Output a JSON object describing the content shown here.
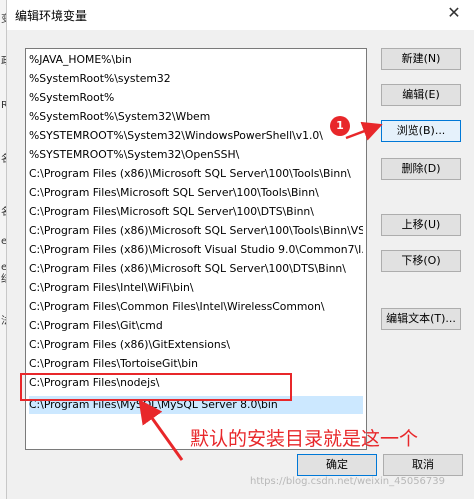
{
  "dialog": {
    "title": "编辑环境变量",
    "close_glyph": "✕"
  },
  "background_window": {
    "fragments": [
      "变",
      "政",
      "R",
      "名",
      "名",
      "e",
      "e",
      "结",
      "法"
    ]
  },
  "path_list": {
    "items": [
      "%JAVA_HOME%\\bin",
      "%SystemRoot%\\system32",
      "%SystemRoot%",
      "%SystemRoot%\\System32\\Wbem",
      "%SYSTEMROOT%\\System32\\WindowsPowerShell\\v1.0\\",
      "%SYSTEMROOT%\\System32\\OpenSSH\\",
      "C:\\Program Files (x86)\\Microsoft SQL Server\\100\\Tools\\Binn\\",
      "C:\\Program Files\\Microsoft SQL Server\\100\\Tools\\Binn\\",
      "C:\\Program Files\\Microsoft SQL Server\\100\\DTS\\Binn\\",
      "C:\\Program Files (x86)\\Microsoft SQL Server\\100\\Tools\\Binn\\VS...",
      "C:\\Program Files (x86)\\Microsoft Visual Studio 9.0\\Common7\\I...",
      "C:\\Program Files (x86)\\Microsoft SQL Server\\100\\DTS\\Binn\\",
      "C:\\Program Files\\Intel\\WiFi\\bin\\",
      "C:\\Program Files\\Common Files\\Intel\\WirelessCommon\\",
      "C:\\Program Files\\Git\\cmd",
      "C:\\Program Files (x86)\\GitExtensions\\",
      "C:\\Program Files\\TortoiseGit\\bin",
      "C:\\Program Files\\nodejs\\",
      "C:\\Program Files\\MySQL\\MySQL Server 8.0\\bin"
    ]
  },
  "buttons": {
    "new": "新建(N)",
    "edit": "编辑(E)",
    "browse": "浏览(B)...",
    "delete": "删除(D)",
    "move_up": "上移(U)",
    "move_down": "下移(O)",
    "edit_text": "编辑文本(T)...",
    "ok": "确定",
    "cancel": "取消"
  },
  "annotation": {
    "badge": "1",
    "text": "默认的安装目录就是这一个",
    "color": "#e8272a"
  },
  "watermark": "https://blog.csdn.net/weixin_45056739"
}
